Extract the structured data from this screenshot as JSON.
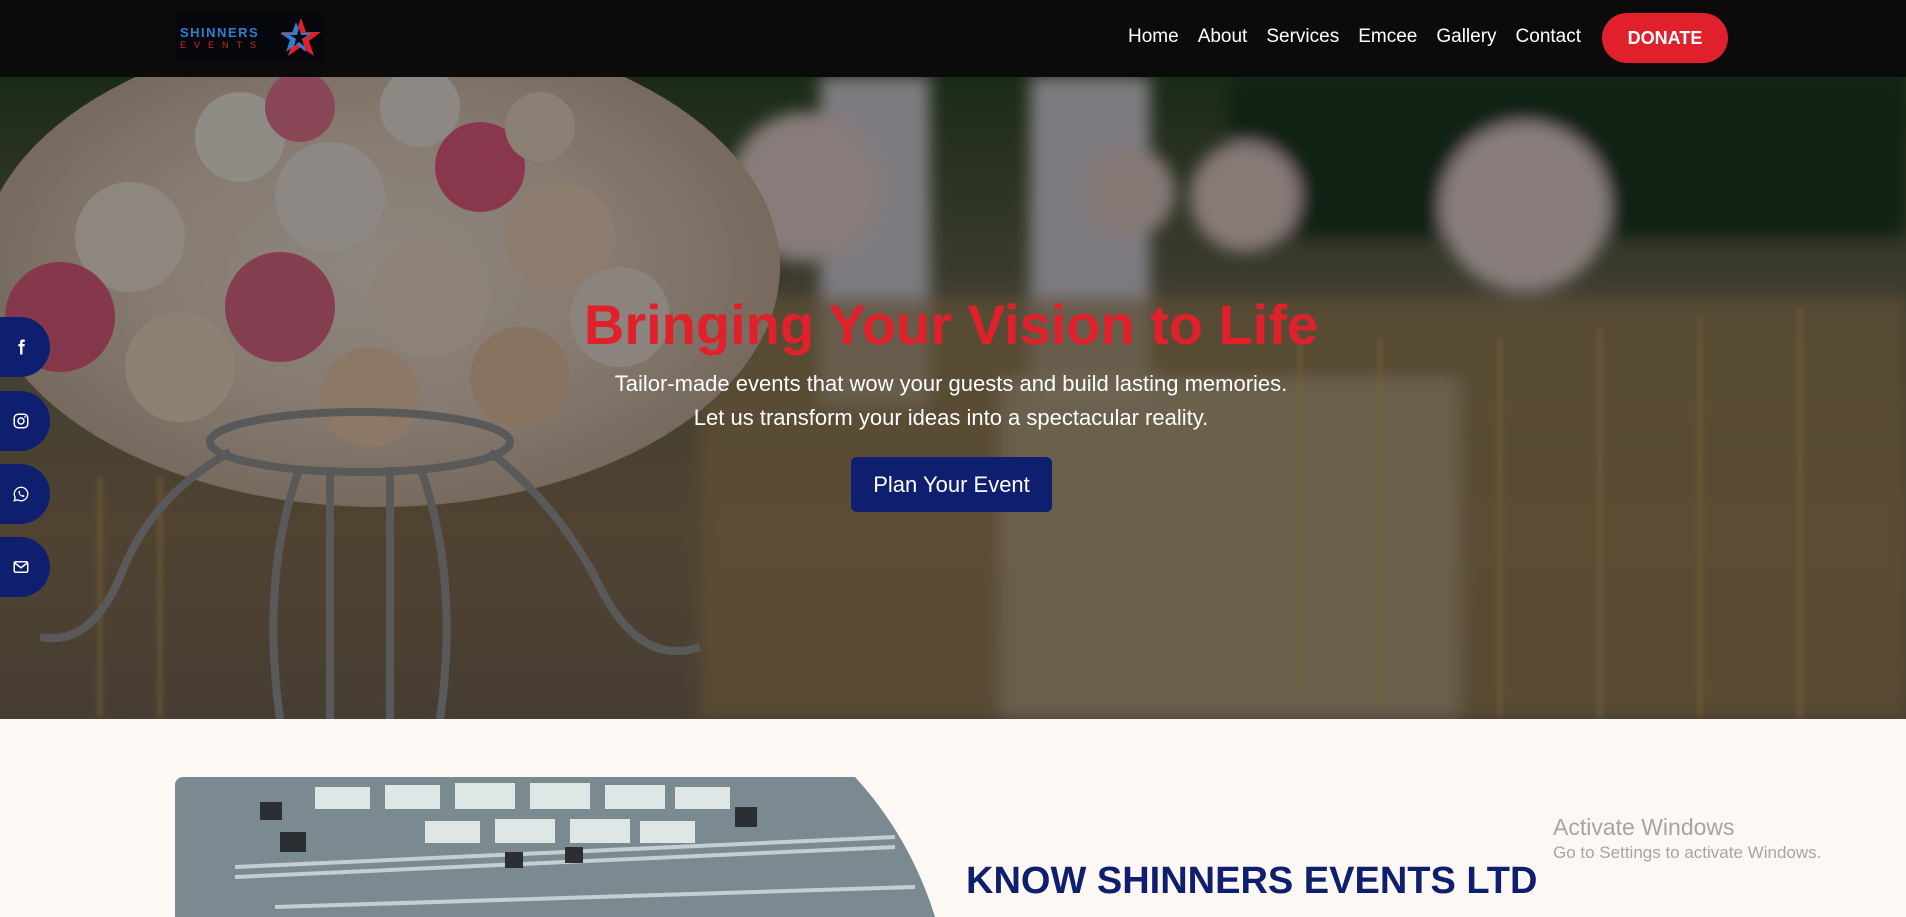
{
  "brand": {
    "name": "SHINNERS",
    "tagline": "EVENTS"
  },
  "nav": {
    "items": [
      {
        "label": "Home"
      },
      {
        "label": "About"
      },
      {
        "label": "Services"
      },
      {
        "label": "Emcee"
      },
      {
        "label": "Gallery"
      },
      {
        "label": "Contact"
      }
    ],
    "donate_label": "DONATE"
  },
  "hero": {
    "title": "Bringing Your Vision to Life",
    "subtitle_line1": "Tailor-made events that wow your guests and build lasting memories.",
    "subtitle_line2": "Let us transform your ideas into a spectacular reality.",
    "cta_label": "Plan Your Event"
  },
  "social": [
    {
      "icon": "facebook-icon"
    },
    {
      "icon": "instagram-icon"
    },
    {
      "icon": "whatsapp-icon"
    },
    {
      "icon": "mail-icon"
    }
  ],
  "about": {
    "title": "KNOW SHINNERS EVENTS LTD"
  },
  "watermark": {
    "title": "Activate Windows",
    "subtitle": "Go to Settings to activate Windows."
  },
  "colors": {
    "header_bg": "#0b0b0b",
    "accent_red": "#e0202a",
    "navy": "#0d1f6e",
    "page_bg": "#fdf8f4"
  }
}
